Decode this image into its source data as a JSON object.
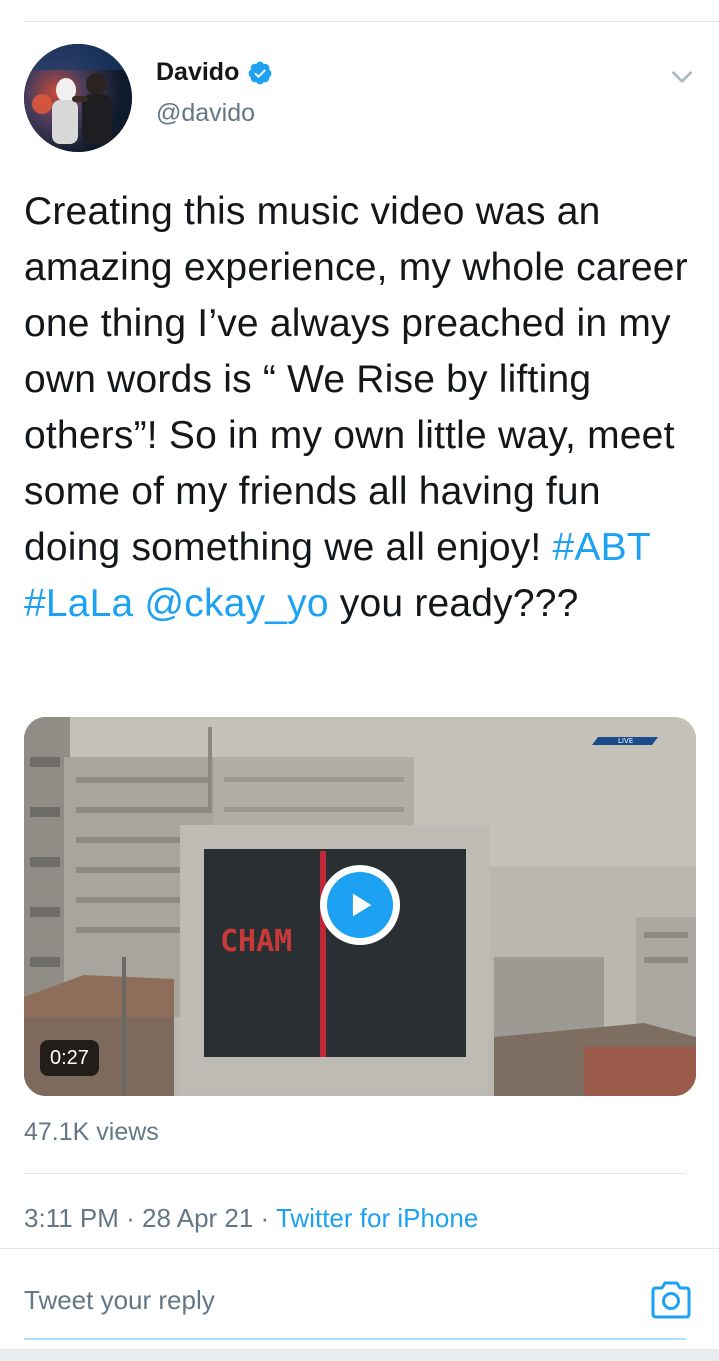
{
  "tweet": {
    "author": {
      "name": "Davido",
      "handle": "@davido",
      "verified": true
    },
    "text_segments": [
      {
        "text": "Creating this music video was an amazing experience, my whole career one thing I’ve always preached in my own words is “ We Rise by lifting others”! So in my own little way, meet some of my friends all having fun doing something we all enjoy! ",
        "link": false
      },
      {
        "text": "#ABT",
        "link": true
      },
      {
        "text": " ",
        "link": false
      },
      {
        "text": "#LaLa",
        "link": true
      },
      {
        "text": " ",
        "link": false
      },
      {
        "text": "@ckay_yo",
        "link": true
      },
      {
        "text": " you ready???",
        "link": false
      }
    ],
    "media": {
      "duration": "0:27",
      "screen_text": "CHAM",
      "live_badge": "LIVE",
      "play_icon": "play-icon"
    },
    "views": "47.1K views",
    "time": "3:11 PM",
    "separator": " · ",
    "date": "28 Apr 21",
    "source": "Twitter for iPhone"
  },
  "reply": {
    "placeholder": "Tweet your reply",
    "camera_icon": "camera-icon"
  },
  "colors": {
    "accent": "#1da1f2",
    "secondary_text": "#657786",
    "primary_text": "#14171a",
    "divider": "#e1e8ed"
  }
}
